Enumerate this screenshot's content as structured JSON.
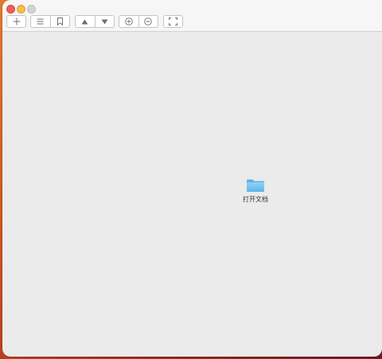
{
  "window": {
    "traffic_lights": {
      "close_color": "#ee5f58",
      "minimize_color": "#f5bd4f",
      "maximize_color": "#d3d3d3"
    }
  },
  "toolbar": {
    "buttons": [
      {
        "name": "add",
        "icon": "plus-icon"
      },
      {
        "name": "list",
        "icon": "list-icon"
      },
      {
        "name": "bookmark",
        "icon": "bookmark-icon"
      },
      {
        "name": "previous-page",
        "icon": "triangle-up-icon"
      },
      {
        "name": "next-page",
        "icon": "triangle-down-icon"
      },
      {
        "name": "zoom-in",
        "icon": "circle-plus-icon"
      },
      {
        "name": "zoom-out",
        "icon": "circle-minus-icon"
      },
      {
        "name": "fullscreen",
        "icon": "fullscreen-icon"
      }
    ]
  },
  "main": {
    "open_document": {
      "icon": "folder-icon",
      "label": "打开文档",
      "folder_color": "#7cc7f0"
    }
  }
}
